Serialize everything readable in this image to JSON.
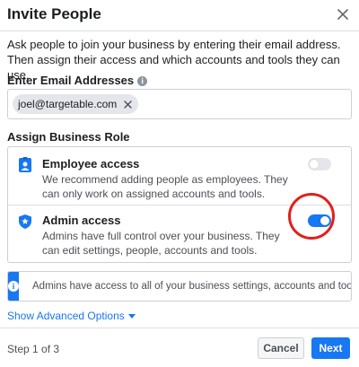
{
  "dialog": {
    "title": "Invite People",
    "intro": "Ask people to join your business by entering their email address. Then assign their access and which accounts and tools they can use."
  },
  "email": {
    "label": "Enter Email Addresses",
    "chips": [
      "joel@targetable.com"
    ]
  },
  "roles": {
    "label": "Assign Business Role",
    "items": [
      {
        "title": "Employee access",
        "description": "We recommend adding people as employees. They can only work on assigned accounts and tools.",
        "enabled": false,
        "icon": "employee-badge-icon"
      },
      {
        "title": "Admin access",
        "description": "Admins have full control over your business. They can edit settings, people, accounts and tools.",
        "enabled": true,
        "icon": "admin-shield-icon"
      }
    ]
  },
  "info_banner": {
    "icon": "info-icon",
    "text": "Admins have access to all of your business settings, accounts and tools."
  },
  "advanced": {
    "label": "Show Advanced Options"
  },
  "footer": {
    "step": "Step 1 of 3",
    "cancel_label": "Cancel",
    "next_label": "Next"
  },
  "colors": {
    "accent": "#1877f2",
    "annotation": "#e0201b",
    "toggle_off": "#e4e6eb"
  }
}
